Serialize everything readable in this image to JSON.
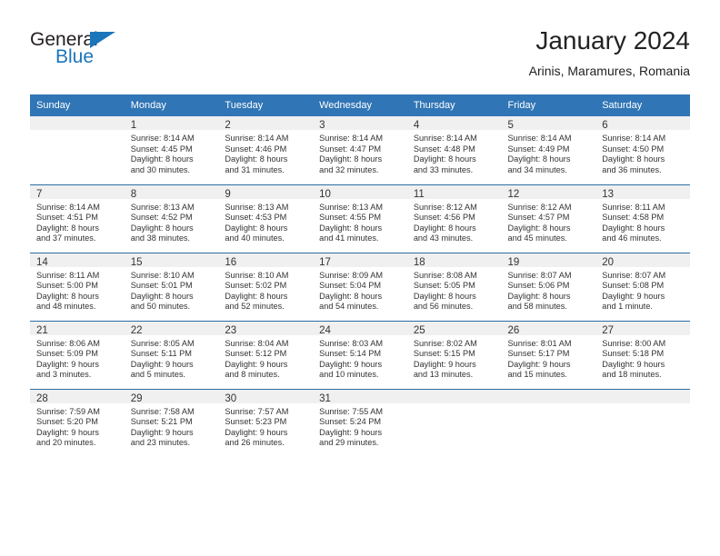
{
  "brand": {
    "name_part1": "General",
    "name_part2": "Blue",
    "triangle_icon": "triangle-icon",
    "color_dark": "#231f20",
    "color_blue": "#1b75bb"
  },
  "header": {
    "title": "January 2024",
    "subtitle": "Arinis, Maramures, Romania"
  },
  "theme": {
    "header_bg": "#3075b5",
    "row_divider": "#2c6ca5",
    "daynum_bg": "#f0f0f0",
    "text": "#333333"
  },
  "weekday_headers": [
    "Sunday",
    "Monday",
    "Tuesday",
    "Wednesday",
    "Thursday",
    "Friday",
    "Saturday"
  ],
  "weeks": [
    [
      {
        "day": "",
        "empty": true,
        "sunrise": "",
        "sunset": "",
        "daylight1": "",
        "daylight2": ""
      },
      {
        "day": "1",
        "sunrise": "Sunrise: 8:14 AM",
        "sunset": "Sunset: 4:45 PM",
        "daylight1": "Daylight: 8 hours",
        "daylight2": "and 30 minutes."
      },
      {
        "day": "2",
        "sunrise": "Sunrise: 8:14 AM",
        "sunset": "Sunset: 4:46 PM",
        "daylight1": "Daylight: 8 hours",
        "daylight2": "and 31 minutes."
      },
      {
        "day": "3",
        "sunrise": "Sunrise: 8:14 AM",
        "sunset": "Sunset: 4:47 PM",
        "daylight1": "Daylight: 8 hours",
        "daylight2": "and 32 minutes."
      },
      {
        "day": "4",
        "sunrise": "Sunrise: 8:14 AM",
        "sunset": "Sunset: 4:48 PM",
        "daylight1": "Daylight: 8 hours",
        "daylight2": "and 33 minutes."
      },
      {
        "day": "5",
        "sunrise": "Sunrise: 8:14 AM",
        "sunset": "Sunset: 4:49 PM",
        "daylight1": "Daylight: 8 hours",
        "daylight2": "and 34 minutes."
      },
      {
        "day": "6",
        "sunrise": "Sunrise: 8:14 AM",
        "sunset": "Sunset: 4:50 PM",
        "daylight1": "Daylight: 8 hours",
        "daylight2": "and 36 minutes."
      }
    ],
    [
      {
        "day": "7",
        "sunrise": "Sunrise: 8:14 AM",
        "sunset": "Sunset: 4:51 PM",
        "daylight1": "Daylight: 8 hours",
        "daylight2": "and 37 minutes."
      },
      {
        "day": "8",
        "sunrise": "Sunrise: 8:13 AM",
        "sunset": "Sunset: 4:52 PM",
        "daylight1": "Daylight: 8 hours",
        "daylight2": "and 38 minutes."
      },
      {
        "day": "9",
        "sunrise": "Sunrise: 8:13 AM",
        "sunset": "Sunset: 4:53 PM",
        "daylight1": "Daylight: 8 hours",
        "daylight2": "and 40 minutes."
      },
      {
        "day": "10",
        "sunrise": "Sunrise: 8:13 AM",
        "sunset": "Sunset: 4:55 PM",
        "daylight1": "Daylight: 8 hours",
        "daylight2": "and 41 minutes."
      },
      {
        "day": "11",
        "sunrise": "Sunrise: 8:12 AM",
        "sunset": "Sunset: 4:56 PM",
        "daylight1": "Daylight: 8 hours",
        "daylight2": "and 43 minutes."
      },
      {
        "day": "12",
        "sunrise": "Sunrise: 8:12 AM",
        "sunset": "Sunset: 4:57 PM",
        "daylight1": "Daylight: 8 hours",
        "daylight2": "and 45 minutes."
      },
      {
        "day": "13",
        "sunrise": "Sunrise: 8:11 AM",
        "sunset": "Sunset: 4:58 PM",
        "daylight1": "Daylight: 8 hours",
        "daylight2": "and 46 minutes."
      }
    ],
    [
      {
        "day": "14",
        "sunrise": "Sunrise: 8:11 AM",
        "sunset": "Sunset: 5:00 PM",
        "daylight1": "Daylight: 8 hours",
        "daylight2": "and 48 minutes."
      },
      {
        "day": "15",
        "sunrise": "Sunrise: 8:10 AM",
        "sunset": "Sunset: 5:01 PM",
        "daylight1": "Daylight: 8 hours",
        "daylight2": "and 50 minutes."
      },
      {
        "day": "16",
        "sunrise": "Sunrise: 8:10 AM",
        "sunset": "Sunset: 5:02 PM",
        "daylight1": "Daylight: 8 hours",
        "daylight2": "and 52 minutes."
      },
      {
        "day": "17",
        "sunrise": "Sunrise: 8:09 AM",
        "sunset": "Sunset: 5:04 PM",
        "daylight1": "Daylight: 8 hours",
        "daylight2": "and 54 minutes."
      },
      {
        "day": "18",
        "sunrise": "Sunrise: 8:08 AM",
        "sunset": "Sunset: 5:05 PM",
        "daylight1": "Daylight: 8 hours",
        "daylight2": "and 56 minutes."
      },
      {
        "day": "19",
        "sunrise": "Sunrise: 8:07 AM",
        "sunset": "Sunset: 5:06 PM",
        "daylight1": "Daylight: 8 hours",
        "daylight2": "and 58 minutes."
      },
      {
        "day": "20",
        "sunrise": "Sunrise: 8:07 AM",
        "sunset": "Sunset: 5:08 PM",
        "daylight1": "Daylight: 9 hours",
        "daylight2": "and 1 minute."
      }
    ],
    [
      {
        "day": "21",
        "sunrise": "Sunrise: 8:06 AM",
        "sunset": "Sunset: 5:09 PM",
        "daylight1": "Daylight: 9 hours",
        "daylight2": "and 3 minutes."
      },
      {
        "day": "22",
        "sunrise": "Sunrise: 8:05 AM",
        "sunset": "Sunset: 5:11 PM",
        "daylight1": "Daylight: 9 hours",
        "daylight2": "and 5 minutes."
      },
      {
        "day": "23",
        "sunrise": "Sunrise: 8:04 AM",
        "sunset": "Sunset: 5:12 PM",
        "daylight1": "Daylight: 9 hours",
        "daylight2": "and 8 minutes."
      },
      {
        "day": "24",
        "sunrise": "Sunrise: 8:03 AM",
        "sunset": "Sunset: 5:14 PM",
        "daylight1": "Daylight: 9 hours",
        "daylight2": "and 10 minutes."
      },
      {
        "day": "25",
        "sunrise": "Sunrise: 8:02 AM",
        "sunset": "Sunset: 5:15 PM",
        "daylight1": "Daylight: 9 hours",
        "daylight2": "and 13 minutes."
      },
      {
        "day": "26",
        "sunrise": "Sunrise: 8:01 AM",
        "sunset": "Sunset: 5:17 PM",
        "daylight1": "Daylight: 9 hours",
        "daylight2": "and 15 minutes."
      },
      {
        "day": "27",
        "sunrise": "Sunrise: 8:00 AM",
        "sunset": "Sunset: 5:18 PM",
        "daylight1": "Daylight: 9 hours",
        "daylight2": "and 18 minutes."
      }
    ],
    [
      {
        "day": "28",
        "sunrise": "Sunrise: 7:59 AM",
        "sunset": "Sunset: 5:20 PM",
        "daylight1": "Daylight: 9 hours",
        "daylight2": "and 20 minutes."
      },
      {
        "day": "29",
        "sunrise": "Sunrise: 7:58 AM",
        "sunset": "Sunset: 5:21 PM",
        "daylight1": "Daylight: 9 hours",
        "daylight2": "and 23 minutes."
      },
      {
        "day": "30",
        "sunrise": "Sunrise: 7:57 AM",
        "sunset": "Sunset: 5:23 PM",
        "daylight1": "Daylight: 9 hours",
        "daylight2": "and 26 minutes."
      },
      {
        "day": "31",
        "sunrise": "Sunrise: 7:55 AM",
        "sunset": "Sunset: 5:24 PM",
        "daylight1": "Daylight: 9 hours",
        "daylight2": "and 29 minutes."
      },
      {
        "day": "",
        "empty": true,
        "sunrise": "",
        "sunset": "",
        "daylight1": "",
        "daylight2": ""
      },
      {
        "day": "",
        "empty": true,
        "sunrise": "",
        "sunset": "",
        "daylight1": "",
        "daylight2": ""
      },
      {
        "day": "",
        "empty": true,
        "sunrise": "",
        "sunset": "",
        "daylight1": "",
        "daylight2": ""
      }
    ]
  ]
}
